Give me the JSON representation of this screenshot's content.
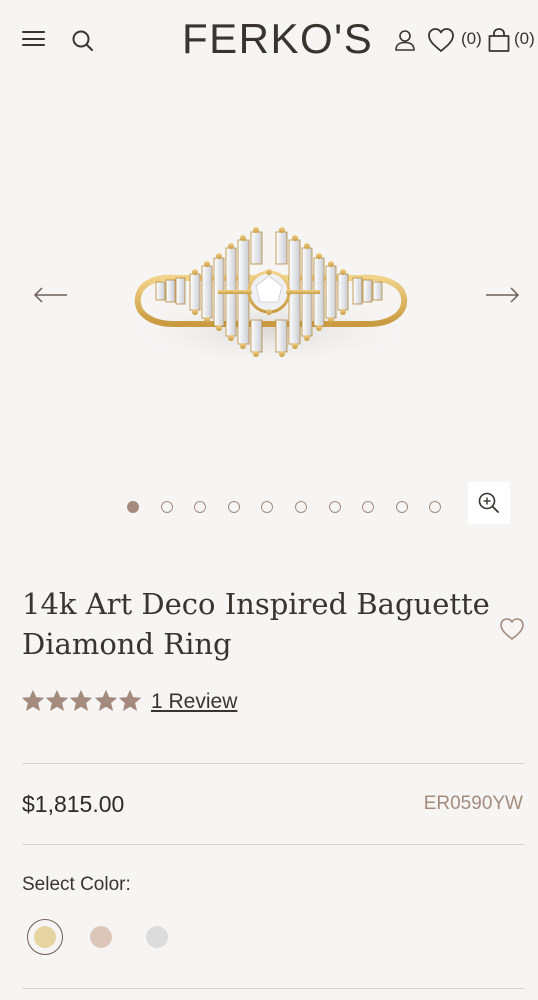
{
  "header": {
    "logo": "FERKO'S",
    "wishlist_count": "(0)",
    "cart_count": "(0)"
  },
  "gallery": {
    "dot_count": 10,
    "active_index": 0
  },
  "product": {
    "title_line1": "14k Art Deco Inspired Baguette",
    "title_line2": "Diamond Ring",
    "rating": 5,
    "review_label": "1 Review",
    "price": "$1,815.00",
    "sku": "ER0590YW",
    "select_color_label": "Select Color:",
    "colors": [
      {
        "name": "yellow-gold",
        "hex": "#e7d4a3",
        "selected": true
      },
      {
        "name": "rose-gold",
        "hex": "#dcc6ba",
        "selected": false
      },
      {
        "name": "white-gold",
        "hex": "#dcdcdc",
        "selected": false
      }
    ]
  },
  "theme": {
    "accent": "#a48b7e",
    "background": "#f6f5f4",
    "text": "#3a3431"
  }
}
